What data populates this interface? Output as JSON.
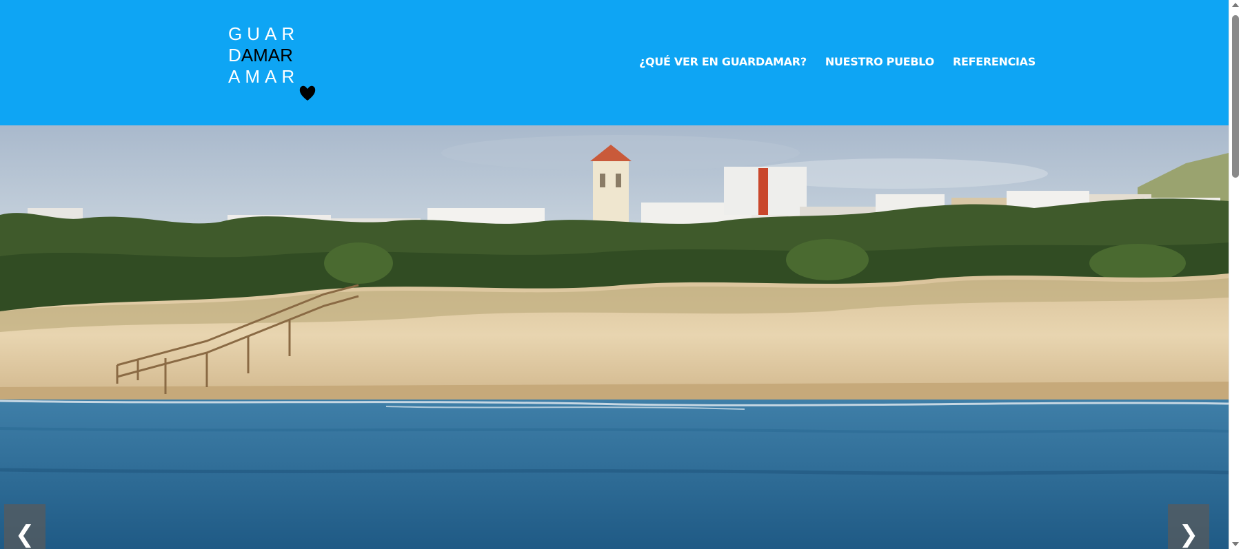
{
  "logo": {
    "line1": "GUAR",
    "line2_first": "D",
    "line2_rest": "AMAR",
    "line3": "AMAR",
    "heart_icon": "heart-icon"
  },
  "nav": {
    "items": [
      {
        "label": "¿QUÉ VER EN GUARDAMAR?"
      },
      {
        "label": "NUESTRO PUEBLO"
      },
      {
        "label": "REFERENCIAS"
      }
    ]
  },
  "slider": {
    "prev_label": "❮",
    "next_label": "❯"
  },
  "colors": {
    "header_bg": "#0ea5f4",
    "nav_text": "#ffffff"
  }
}
